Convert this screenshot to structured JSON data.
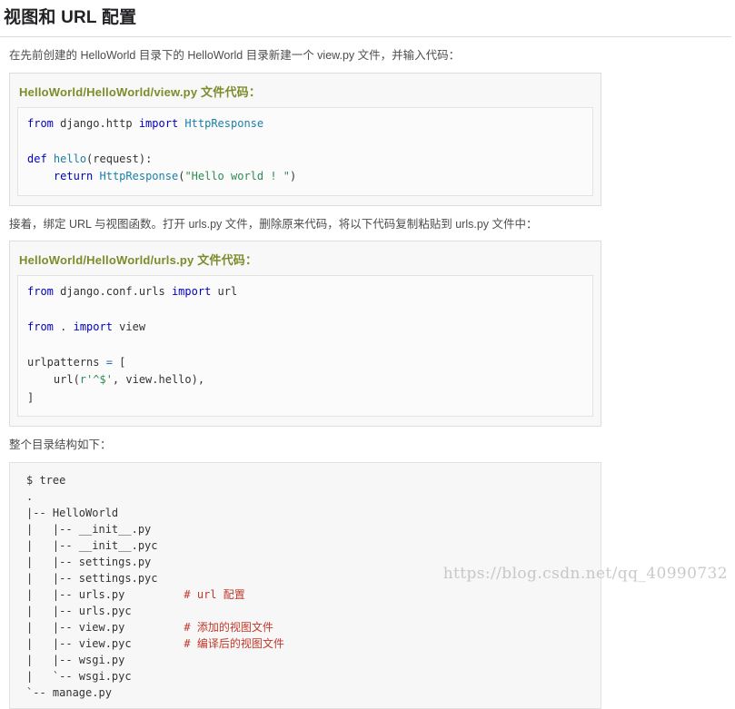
{
  "page": {
    "title": "视图和 URL 配置",
    "intro": "在先前创建的 HelloWorld 目录下的 HelloWorld 目录新建一个 view.py 文件，并输入代码：",
    "middle_para": "接着，绑定 URL 与视图函数。打开 urls.py 文件，删除原来代码，将以下代码复制粘贴到 urls.py 文件中：",
    "tree_para": "整个目录结构如下：",
    "watermark": "https://blog.csdn.net/qq_40990732"
  },
  "view_block": {
    "heading": "HelloWorld/HelloWorld/view.py 文件代码：",
    "lines": [
      "from django.http import HttpResponse",
      "",
      "def hello(request):",
      "    return HttpResponse(\"Hello world ! \")"
    ]
  },
  "urls_block": {
    "heading": "HelloWorld/HelloWorld/urls.py 文件代码：",
    "lines": [
      "from django.conf.urls import url",
      "",
      "from . import view",
      "",
      "urlpatterns = [",
      "    url(r'^$', view.hello),",
      "]"
    ]
  },
  "tree_block": {
    "lines": [
      {
        "text": "$ tree",
        "comment": ""
      },
      {
        "text": ".",
        "comment": ""
      },
      {
        "text": "|-- HelloWorld",
        "comment": ""
      },
      {
        "text": "|   |-- __init__.py",
        "comment": ""
      },
      {
        "text": "|   |-- __init__.pyc",
        "comment": ""
      },
      {
        "text": "|   |-- settings.py",
        "comment": ""
      },
      {
        "text": "|   |-- settings.pyc",
        "comment": ""
      },
      {
        "text": "|   |-- urls.py",
        "comment": "# url 配置"
      },
      {
        "text": "|   |-- urls.pyc",
        "comment": ""
      },
      {
        "text": "|   |-- view.py",
        "comment": "# 添加的视图文件"
      },
      {
        "text": "|   |-- view.pyc",
        "comment": "# 编译后的视图文件"
      },
      {
        "text": "|   |-- wsgi.py",
        "comment": ""
      },
      {
        "text": "|   `-- wsgi.pyc",
        "comment": ""
      },
      {
        "text": "`-- manage.py",
        "comment": ""
      }
    ]
  },
  "colors": {
    "heading_green": "#7b8c2a",
    "comment_red": "#c0392b",
    "keyword_blue": "#0000c0",
    "string_green": "#2e8b57"
  }
}
